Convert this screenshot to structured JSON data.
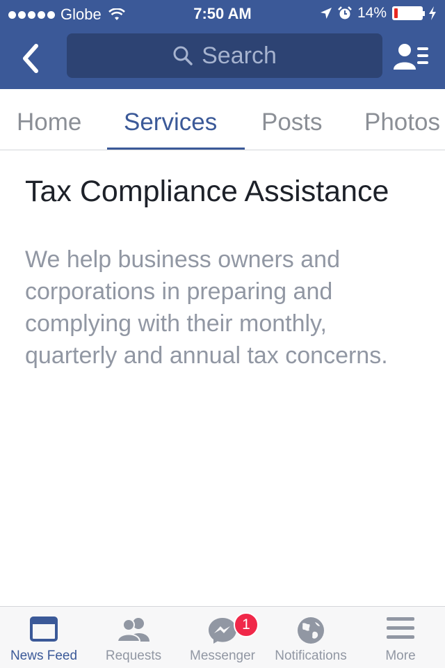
{
  "status_bar": {
    "carrier": "Globe",
    "time": "7:50 AM",
    "battery": "14%",
    "battery_level": 0.14,
    "signal_icon": "signal-dots-icon",
    "wifi_icon": "wifi-icon",
    "location_icon": "location-arrow-icon",
    "alarm_icon": "alarm-icon",
    "charging_icon": "charging-bolt-icon"
  },
  "nav": {
    "search_placeholder": "Search",
    "back_icon": "chevron-left-icon",
    "friends_icon": "friends-list-icon"
  },
  "tabs": [
    {
      "label": "Home",
      "active": false
    },
    {
      "label": "Services",
      "active": true
    },
    {
      "label": "Posts",
      "active": false
    },
    {
      "label": "Photos",
      "active": false
    }
  ],
  "service": {
    "title": "Tax Compliance Assistance",
    "description": "We help business owners and corporations in preparing and complying with their monthly, quarterly and annual tax concerns."
  },
  "bottom_bar": [
    {
      "label": "News Feed",
      "icon": "news-feed-icon",
      "active": true
    },
    {
      "label": "Requests",
      "icon": "requests-icon",
      "active": false
    },
    {
      "label": "Messenger",
      "icon": "messenger-icon",
      "active": false,
      "badge": "1"
    },
    {
      "label": "Notifications",
      "icon": "globe-icon",
      "active": false
    },
    {
      "label": "More",
      "icon": "menu-icon",
      "active": false
    }
  ],
  "colors": {
    "brand": "#3b5998",
    "badge": "#f02849",
    "battery_low": "#e8281f"
  }
}
